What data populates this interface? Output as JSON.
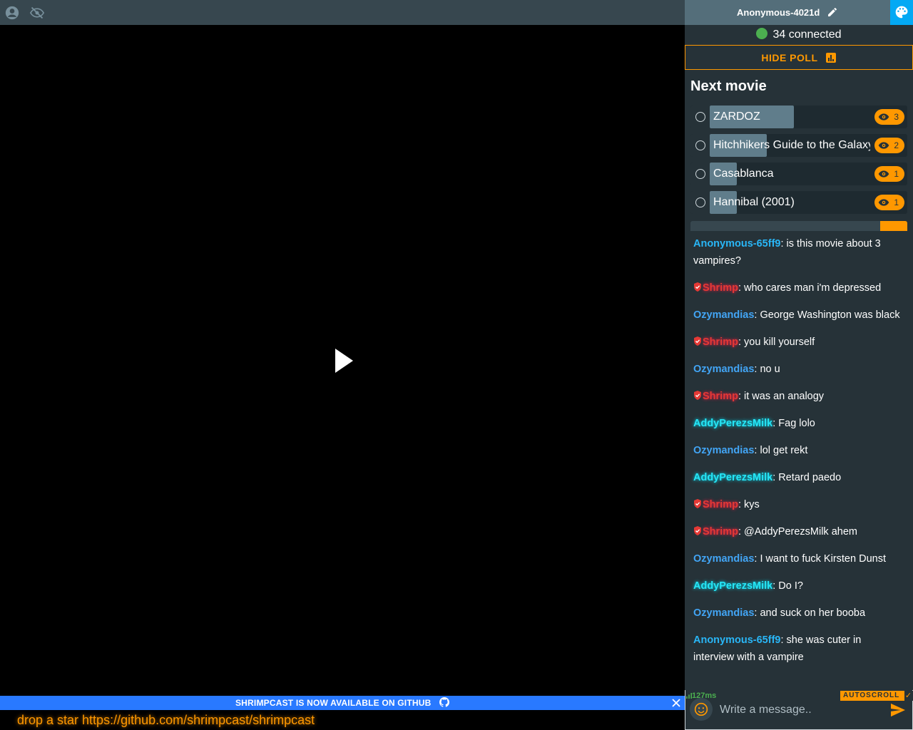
{
  "colors": {
    "accent": "#ff9800",
    "header": "#546e7a",
    "sidebar_bg": "#263238",
    "banner": "#2979ff",
    "online": "#4caf50",
    "palette": "#03a9f4"
  },
  "topbar": {
    "icons": [
      "account-icon",
      "visibility-off-icon"
    ]
  },
  "video": {
    "state": "paused",
    "icon": "play-icon"
  },
  "banner": {
    "text": "SHRIMPCAST IS NOW AVAILABLE ON GITHUB"
  },
  "ticker": {
    "text": "drop a star https://github.com/shrimpcast/shrimpcast"
  },
  "sidebar": {
    "username": "Anonymous-4021d",
    "connected_text": "34 connected",
    "hide_poll_label": "HIDE POLL"
  },
  "poll": {
    "title": "Next movie",
    "options": [
      {
        "label": "ZARDOZ",
        "votes": "3",
        "share": 0.4
      },
      {
        "label": "Hitchhikers Guide to the Galaxy",
        "votes": "2",
        "share": 0.27
      },
      {
        "label": "Casablanca",
        "votes": "1",
        "share": 0.13
      },
      {
        "label": "Hannibal (2001)",
        "votes": "1",
        "share": 0.13
      }
    ]
  },
  "chat": {
    "messages": [
      {
        "user": "Anonymous-65ff9",
        "kind": "anon",
        "text": ": is this movie about 3 vampires?"
      },
      {
        "user": "Shrimp",
        "kind": "shrimp",
        "text": ": who cares man i'm depressed"
      },
      {
        "user": "Ozymandias",
        "kind": "ozy",
        "text": ": George Washington was black"
      },
      {
        "user": "Shrimp",
        "kind": "shrimp",
        "text": ": you kill yourself"
      },
      {
        "user": "Ozymandias",
        "kind": "ozy",
        "text": ": no u"
      },
      {
        "user": "Shrimp",
        "kind": "shrimp",
        "text": ": it was an analogy"
      },
      {
        "user": "AddyPerezsMilk",
        "kind": "addy",
        "text": ": Fag lolo"
      },
      {
        "user": "Ozymandias",
        "kind": "ozy",
        "text": ": lol get rekt"
      },
      {
        "user": "AddyPerezsMilk",
        "kind": "addy",
        "text": ": Retard paedo"
      },
      {
        "user": "Shrimp",
        "kind": "shrimp",
        "text": ": kys"
      },
      {
        "user": "Shrimp",
        "kind": "shrimp",
        "text": ": @AddyPerezsMilk ahem"
      },
      {
        "user": "Ozymandias",
        "kind": "ozy",
        "text": ": I want to fuck Kirsten Dunst"
      },
      {
        "user": "AddyPerezsMilk",
        "kind": "addy",
        "text": ": Do I?"
      },
      {
        "user": "Ozymandias",
        "kind": "ozy",
        "text": ": and suck on her booba"
      },
      {
        "user": "Anonymous-65ff9",
        "kind": "anon",
        "text": ": she was cuter in interview with a vampire"
      }
    ]
  },
  "composer": {
    "ping": "127ms",
    "autoscroll_label": "AUTOSCROLL",
    "placeholder": "Write a message..",
    "value": ""
  }
}
